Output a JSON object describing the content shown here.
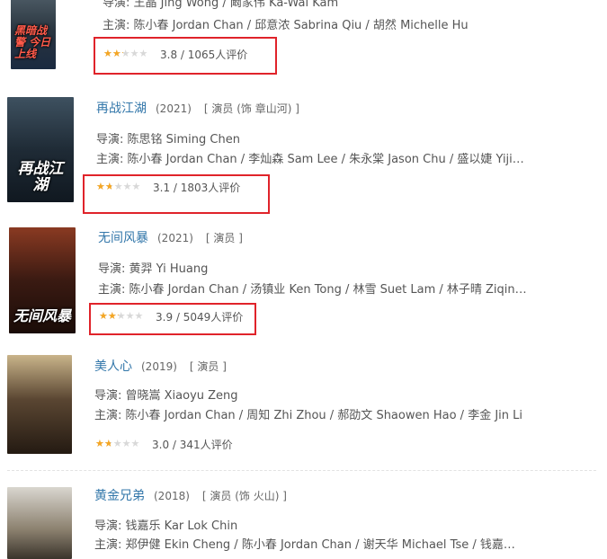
{
  "labels": {
    "director_prefix": "导演: ",
    "cast_prefix": "主演: "
  },
  "colors": {
    "title_link": "#3377aa",
    "star_filled": "#f5a623",
    "highlight_box": "#e0232a"
  },
  "movies": [
    {
      "title": "",
      "year": "",
      "role": "",
      "poster_text": "黑暗战警 今日上线",
      "director": "王晶 Jing Wong / 阚家伟 Ka-Wai Kam",
      "cast": "陈小春 Jordan Chan / 邱意浓 Sabrina Qiu / 胡然 Michelle Hu",
      "rating_value": "3.8 / 1065人评价",
      "rating_stars": 2,
      "highlighted": true
    },
    {
      "title": "再战江湖",
      "year": "(2021)",
      "role": "[ 演员 (饰 章山河) ]",
      "poster_text": "再战江湖",
      "director": "陈思铭 Siming Chen",
      "cast": "陈小春 Jordan Chan / 李灿森 Sam Lee / 朱永棠 Jason Chu / 盛以婕 Yijie Sh...",
      "rating_value": "3.1 / 1803人评价",
      "rating_stars": 1.5,
      "highlighted": true
    },
    {
      "title": "无间风暴",
      "year": "(2021)",
      "role": "[ 演员 ]",
      "poster_text": "无间风暴",
      "director": "黄羿 Yi Huang",
      "cast": "陈小春 Jordan Chan / 汤镇业 Ken Tong / 林雪 Suet Lam / 林子晴 Ziqing Lin...",
      "rating_value": "3.9 / 5049人评价",
      "rating_stars": 2,
      "highlighted": true
    },
    {
      "title": "美人心",
      "year": "(2019)",
      "role": "[ 演员 ]",
      "poster_text": "",
      "director": "曾晓嵩 Xiaoyu Zeng",
      "cast": "陈小春 Jordan Chan / 周知 Zhi Zhou / 郝劭文 Shaowen Hao / 李金 Jin Li",
      "rating_value": "3.0 / 341人评价",
      "rating_stars": 1.5,
      "highlighted": false
    },
    {
      "title": "黄金兄弟",
      "year": "(2018)",
      "role": "[ 演员 (饰 火山) ]",
      "poster_text": "",
      "director": "钱嘉乐 Kar Lok Chin",
      "cast": "郑伊健 Ekin Cheng / 陈小春 Jordan Chan / 谢天华 Michael Tse / 钱嘉乐 Kar...",
      "rating_value": "",
      "rating_stars": 0,
      "highlighted": false
    }
  ]
}
